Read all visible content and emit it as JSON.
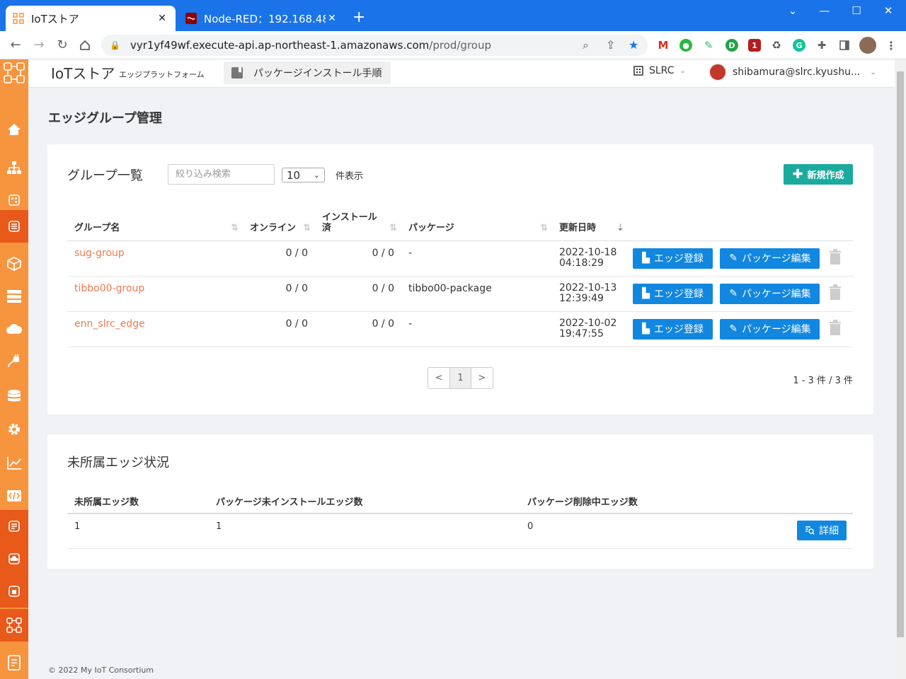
{
  "browser": {
    "tabs": [
      {
        "title": "IoTストア",
        "active": true
      },
      {
        "title": "Node-RED：192.168.48",
        "active": false
      }
    ],
    "url_host": "vyr1yf49wf.execute-api.ap-northeast-1.amazonaws.com",
    "url_path": "/prod/group"
  },
  "header": {
    "brand": "IoTストア",
    "brand_sub": "エッジプラットフォーム",
    "guide_button": "パッケージインストール手順",
    "org": "SLRC",
    "user": "shibamura@slrc.kyushu..."
  },
  "page_title": "エッジグループ管理",
  "groups_card": {
    "title": "グループ一覧",
    "search_placeholder": "絞り込み検索",
    "page_size": "10",
    "page_size_suffix": "件表示",
    "new_button": "新規作成",
    "columns": {
      "name": "グループ名",
      "online": "オンライン",
      "installed": "インストール済",
      "package": "パッケージ",
      "updated": "更新日時"
    },
    "rows": [
      {
        "name": "sug-group",
        "online": "0 / 0",
        "installed": "0 / 0",
        "package": "-",
        "date": "2022-10-18",
        "time": "04:18:29"
      },
      {
        "name": "tibbo00-group",
        "online": "0 / 0",
        "installed": "0 / 0",
        "package": "tibbo00-package",
        "date": "2022-10-13",
        "time": "12:39:49"
      },
      {
        "name": "enn_slrc_edge",
        "online": "0 / 0",
        "installed": "0 / 0",
        "package": "-",
        "date": "2022-10-02",
        "time": "19:47:55"
      }
    ],
    "edge_register_label": "エッジ登録",
    "package_edit_label": "パッケージ編集",
    "pager": {
      "prev": "<",
      "current": "1",
      "next": ">"
    },
    "page_info": "1 - 3 件 / 3 件"
  },
  "unassigned_card": {
    "title": "未所属エッジ状況",
    "columns": {
      "count": "未所属エッジ数",
      "not_installed": "パッケージ未インストールエッジ数",
      "deleting": "パッケージ削除中エッジ数"
    },
    "values": {
      "count": "1",
      "not_installed": "1",
      "deleting": "0"
    },
    "detail_button": "詳細"
  },
  "footer": "© 2022 My IoT Consortium",
  "colors": {
    "chrome_blue": "#1a73e8",
    "sidebar_orange": "#f7943e",
    "sidebar_dark_orange": "#e8591a",
    "teal": "#1aaa9e",
    "primary_blue": "#1187e0",
    "link_orange": "#ee7a4f"
  }
}
